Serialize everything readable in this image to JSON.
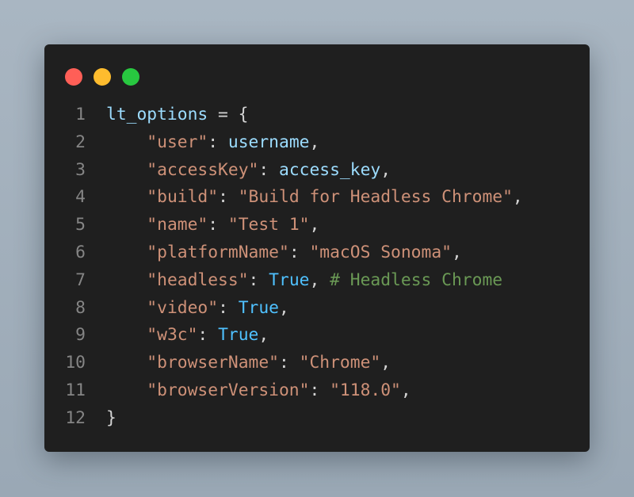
{
  "window": {
    "controls": [
      {
        "name": "close",
        "color": "#ff5f57"
      },
      {
        "name": "minimize",
        "color": "#febc2e"
      },
      {
        "name": "maximize",
        "color": "#28c840"
      }
    ]
  },
  "theme": {
    "background": "#1f1f1f",
    "line_number": "#858585",
    "variable": "#9cdcfe",
    "punctuation": "#d4d4d4",
    "string": "#ce9178",
    "constant": "#4fc1ff",
    "comment": "#6a9955"
  },
  "code": {
    "lines": [
      {
        "num": "1",
        "tokens": [
          {
            "text": "lt_options",
            "type": "variable"
          },
          {
            "text": " = {",
            "type": "punctuation"
          }
        ]
      },
      {
        "num": "2",
        "tokens": [
          {
            "text": "    ",
            "type": "punctuation"
          },
          {
            "text": "\"user\"",
            "type": "string"
          },
          {
            "text": ": ",
            "type": "punctuation"
          },
          {
            "text": "username",
            "type": "variable"
          },
          {
            "text": ",",
            "type": "punctuation"
          }
        ]
      },
      {
        "num": "3",
        "tokens": [
          {
            "text": "    ",
            "type": "punctuation"
          },
          {
            "text": "\"accessKey\"",
            "type": "string"
          },
          {
            "text": ": ",
            "type": "punctuation"
          },
          {
            "text": "access_key",
            "type": "variable"
          },
          {
            "text": ",",
            "type": "punctuation"
          }
        ]
      },
      {
        "num": "4",
        "tokens": [
          {
            "text": "    ",
            "type": "punctuation"
          },
          {
            "text": "\"build\"",
            "type": "string"
          },
          {
            "text": ": ",
            "type": "punctuation"
          },
          {
            "text": "\"Build for Headless Chrome\"",
            "type": "string"
          },
          {
            "text": ",",
            "type": "punctuation"
          }
        ]
      },
      {
        "num": "5",
        "tokens": [
          {
            "text": "    ",
            "type": "punctuation"
          },
          {
            "text": "\"name\"",
            "type": "string"
          },
          {
            "text": ": ",
            "type": "punctuation"
          },
          {
            "text": "\"Test 1\"",
            "type": "string"
          },
          {
            "text": ",",
            "type": "punctuation"
          }
        ]
      },
      {
        "num": "6",
        "tokens": [
          {
            "text": "    ",
            "type": "punctuation"
          },
          {
            "text": "\"platformName\"",
            "type": "string"
          },
          {
            "text": ": ",
            "type": "punctuation"
          },
          {
            "text": "\"macOS Sonoma\"",
            "type": "string"
          },
          {
            "text": ",",
            "type": "punctuation"
          }
        ]
      },
      {
        "num": "7",
        "tokens": [
          {
            "text": "    ",
            "type": "punctuation"
          },
          {
            "text": "\"headless\"",
            "type": "string"
          },
          {
            "text": ": ",
            "type": "punctuation"
          },
          {
            "text": "True",
            "type": "constant"
          },
          {
            "text": ", ",
            "type": "punctuation"
          },
          {
            "text": "# Headless Chrome",
            "type": "comment"
          }
        ]
      },
      {
        "num": "8",
        "tokens": [
          {
            "text": "    ",
            "type": "punctuation"
          },
          {
            "text": "\"video\"",
            "type": "string"
          },
          {
            "text": ": ",
            "type": "punctuation"
          },
          {
            "text": "True",
            "type": "constant"
          },
          {
            "text": ",",
            "type": "punctuation"
          }
        ]
      },
      {
        "num": "9",
        "tokens": [
          {
            "text": "    ",
            "type": "punctuation"
          },
          {
            "text": "\"w3c\"",
            "type": "string"
          },
          {
            "text": ": ",
            "type": "punctuation"
          },
          {
            "text": "True",
            "type": "constant"
          },
          {
            "text": ",",
            "type": "punctuation"
          }
        ]
      },
      {
        "num": "10",
        "tokens": [
          {
            "text": "    ",
            "type": "punctuation"
          },
          {
            "text": "\"browserName\"",
            "type": "string"
          },
          {
            "text": ": ",
            "type": "punctuation"
          },
          {
            "text": "\"Chrome\"",
            "type": "string"
          },
          {
            "text": ",",
            "type": "punctuation"
          }
        ]
      },
      {
        "num": "11",
        "tokens": [
          {
            "text": "    ",
            "type": "punctuation"
          },
          {
            "text": "\"browserVersion\"",
            "type": "string"
          },
          {
            "text": ": ",
            "type": "punctuation"
          },
          {
            "text": "\"118.0\"",
            "type": "string"
          },
          {
            "text": ",",
            "type": "punctuation"
          }
        ]
      },
      {
        "num": "12",
        "tokens": [
          {
            "text": "}",
            "type": "punctuation"
          }
        ]
      }
    ]
  }
}
